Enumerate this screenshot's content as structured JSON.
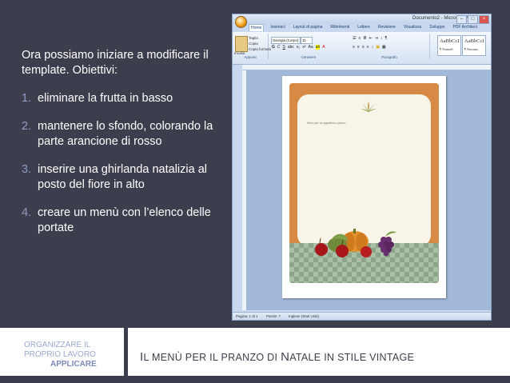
{
  "slide": {
    "intro": "Ora possiamo iniziare a modificare il template. Obiettivi:",
    "goals": [
      {
        "num": "1.",
        "text": "eliminare la frutta in basso"
      },
      {
        "num": "2.",
        "text": "mantenere lo sfondo, colorando la parte arancione di rosso"
      },
      {
        "num": "3.",
        "text": "inserire una ghirlanda natalizia al posto del fiore in alto"
      },
      {
        "num": "4.",
        "text": "creare un menù con l’elenco delle portate"
      }
    ]
  },
  "footer": {
    "section_line1": "ORGANIZZARE IL",
    "section_line2": "PROPRIO LAVORO",
    "section_line3": "APPLICARE",
    "title_first_letter": "I",
    "title_rest_1": "L MENÙ PER IL PRANZO DI ",
    "title_cap_n": "N",
    "title_rest_2": "ATALE IN STILE VINTAGE"
  },
  "word": {
    "window_title": "Documento2 - Microsoft Word",
    "tabs": [
      "Home",
      "Inserisci",
      "Layout di pagina",
      "Riferimenti",
      "Lettere",
      "Revisione",
      "Visualizza",
      "Sviluppo",
      "PDF Architect"
    ],
    "clipboard": {
      "cut": "Taglia",
      "copy": "Copia",
      "format_painter": "Copia formato",
      "paste": "Incolla",
      "group": "Appunti"
    },
    "font": {
      "name": "Georgia (Corpo)",
      "size": "11",
      "group": "Carattere"
    },
    "paragraph_group": "Paragrafo",
    "styles": [
      {
        "sample": "AaBbCcI",
        "name": "¶ Normale"
      },
      {
        "sample": "AaBbCcI",
        "name": "¶ Nessuna..."
      }
    ],
    "template_text": "Menù per un appetitoso pranzo",
    "status": {
      "page": "Pagina: 1 di 1",
      "words": "Parole: 7",
      "language": "Inglese (Stati Uniti)"
    }
  }
}
